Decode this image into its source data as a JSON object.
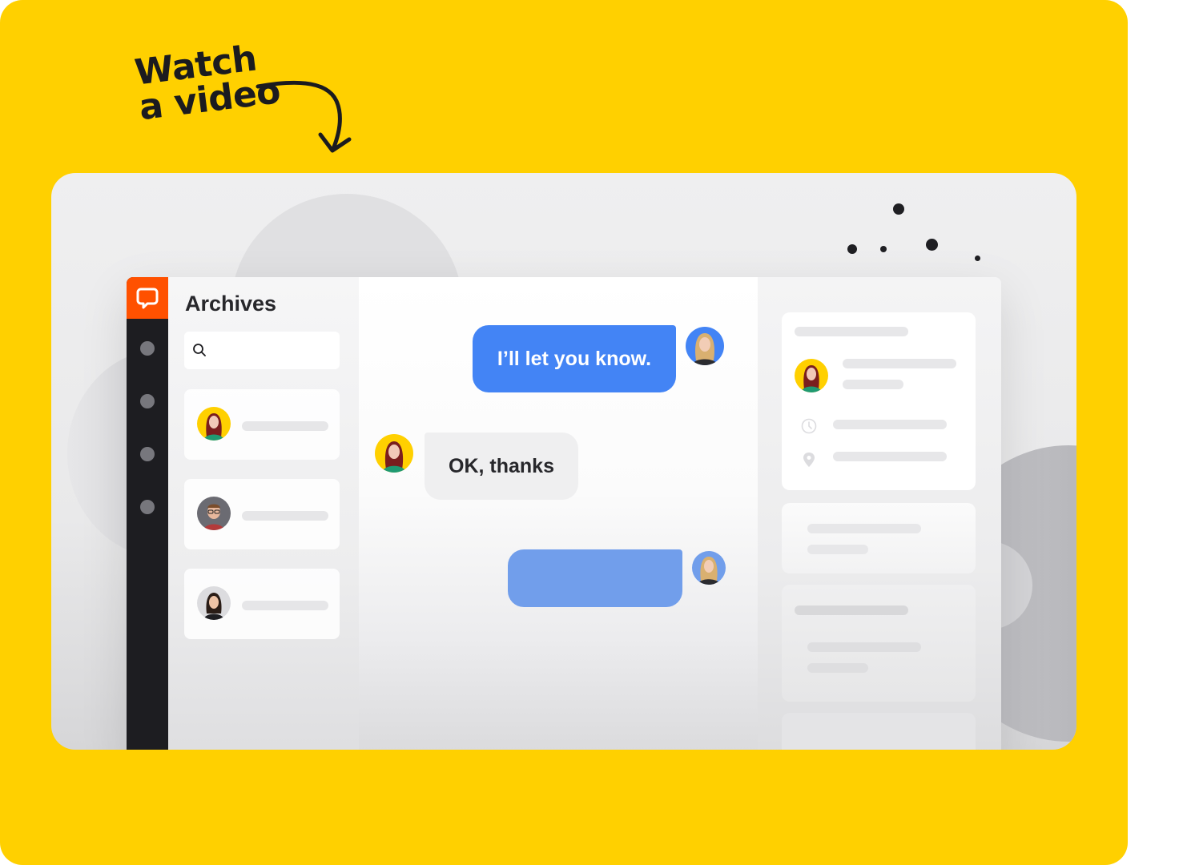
{
  "promo": {
    "headline_line1": "Watch",
    "headline_line2": "a video",
    "arrow_icon": "curved-arrow-down-icon"
  },
  "colors": {
    "background_card": "#FFD000",
    "brand_orange": "#FF5100",
    "rail_dark": "#1D1D21",
    "outgoing_bubble": "#4384F5",
    "outgoing_bubble_faded": "#719EEB",
    "incoming_bubble": "#EFEFF0"
  },
  "app": {
    "logo_icon": "chat-bubble-logo-icon",
    "rail_items": [
      {
        "icon": "nav-dot-icon"
      },
      {
        "icon": "nav-dot-icon"
      },
      {
        "icon": "nav-dot-icon"
      },
      {
        "icon": "nav-dot-icon"
      }
    ],
    "archives": {
      "title": "Archives",
      "search": {
        "value": "",
        "placeholder": "",
        "icon": "search-icon"
      },
      "conversations": [
        {
          "avatar": "avatar-red-haired-woman"
        },
        {
          "avatar": "avatar-bearded-man-glasses"
        },
        {
          "avatar": "avatar-dark-haired-woman"
        }
      ]
    },
    "chat": {
      "messages": [
        {
          "direction": "outgoing",
          "text": "I’ll let you know.",
          "avatar": "avatar-blonde-agent"
        },
        {
          "direction": "incoming",
          "text": "OK, thanks",
          "avatar": "avatar-red-haired-woman"
        },
        {
          "direction": "outgoing",
          "text": "",
          "avatar": "avatar-blonde-agent"
        }
      ]
    },
    "details": {
      "customer_avatar": "avatar-red-haired-woman",
      "icons": [
        "clock-icon",
        "location-pin-icon"
      ]
    }
  }
}
